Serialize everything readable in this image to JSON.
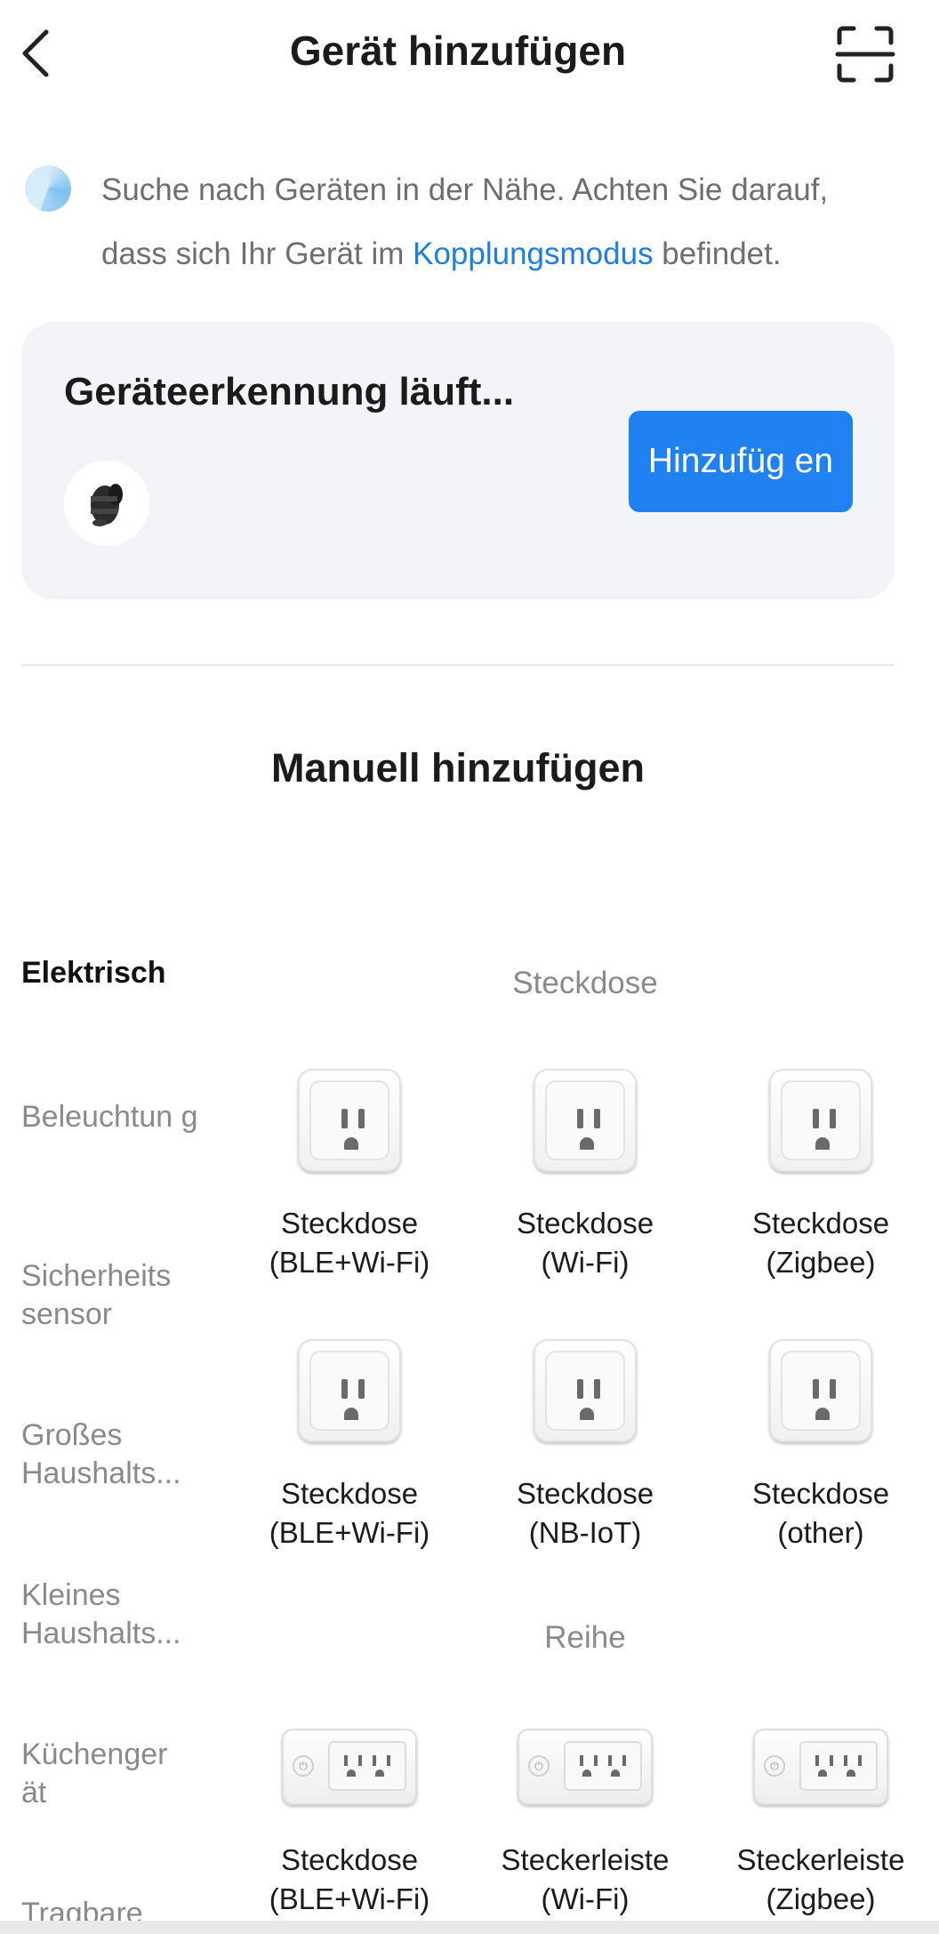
{
  "header": {
    "title": "Gerät hinzufügen",
    "back_icon": "chevron-left-icon",
    "scan_icon": "scan-frame-icon"
  },
  "info": {
    "text_before": "Suche nach Geräten in der Nähe. Achten Sie darauf, dass sich Ihr Gerät im ",
    "link": "Kopplungsmodus",
    "text_after": " befindet."
  },
  "detection": {
    "title": "Geräteerkennung läuft...",
    "add_button": "Hinzufüg en"
  },
  "manual": {
    "title": "Manuell hinzufügen"
  },
  "categories": [
    {
      "label": "Elektrisch",
      "active": true
    },
    {
      "label": "Beleuchtun g"
    },
    {
      "label": "Sicherheits sensor"
    },
    {
      "label": "Großes Haushalts..."
    },
    {
      "label": "Kleines Haushalts..."
    },
    {
      "label": "Küchenger ät"
    },
    {
      "label": "Tragbare"
    }
  ],
  "groups": [
    {
      "label": "Steckdose",
      "items": [
        {
          "line1": "Steckdose",
          "line2": "(BLE+Wi-Fi)"
        },
        {
          "line1": "Steckdose",
          "line2": "(Wi-Fi)"
        },
        {
          "line1": "Steckdose",
          "line2": "(Zigbee)"
        },
        {
          "line1": "Steckdose",
          "line2": "(BLE+Wi-Fi)"
        },
        {
          "line1": "Steckdose",
          "line2": "(NB-IoT)"
        },
        {
          "line1": "Steckdose",
          "line2": "(other)"
        }
      ]
    },
    {
      "label": "Reihe",
      "items": [
        {
          "line1": "Steckdose",
          "line2": "(BLE+Wi-Fi)"
        },
        {
          "line1": "Steckerleiste",
          "line2": "(Wi-Fi)"
        },
        {
          "line1": "Steckerleiste",
          "line2": "(Zigbee)"
        }
      ]
    }
  ],
  "colors": {
    "accent": "#1f82f0",
    "link": "#1a7fe0",
    "card_bg": "#f3f4f8"
  }
}
